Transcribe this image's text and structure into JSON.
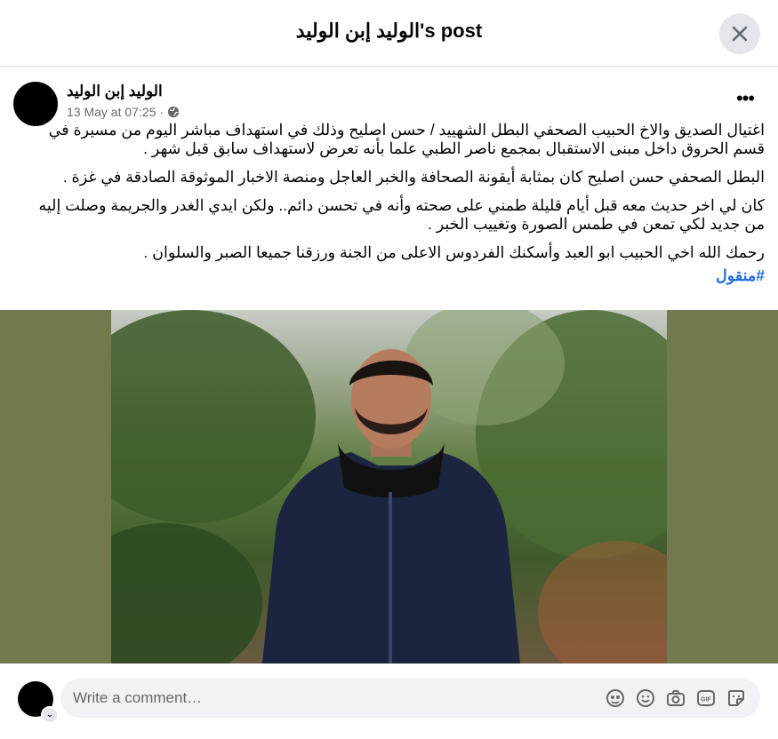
{
  "header": {
    "title": "الوليد إبن الوليد's post"
  },
  "post": {
    "author": "الوليد إبن الوليد",
    "timestamp": "13 May at 07:25",
    "visibility_icon": "globe-icon",
    "paragraphs": [
      "اغتيال الصديق والاخ الحبيب الصحفي البطل الشهييد / حسن اصليح وذلك في استهداف مباشر اليوم من مسيرة في قسم الحروق داخل مبنى الاستقبال بمجمع ناصر الطبي علما بأنه تعرض لاستهداف سابق قبل شهر .",
      "البطل الصحفي حسن اصليح كان بمثابة أيقونة الصحافة والخبر العاجل ومنصة الاخبار الموثوقة الصادقة في غزة .",
      "كان لي اخر حديث معه قبل أيام قليلة طمني على صحته وأنه في تحسن دائم.. ولكن ايدي الغدر والجريمة وصلت إليه من جديد لكي تمعن في طمس الصورة وتغييب الخبر .",
      "رحمك الله اخي الحبيب ابو العبد وأسكنك الفردوس الاعلى من الجنة ورزقنا جميعا الصبر والسلوان ."
    ],
    "hashtag": "#منقول"
  },
  "comment": {
    "placeholder": "Write a comment…",
    "tools": [
      "avatar-sticker-icon",
      "emoji-icon",
      "camera-icon",
      "gif-icon",
      "sticker-icon"
    ]
  }
}
